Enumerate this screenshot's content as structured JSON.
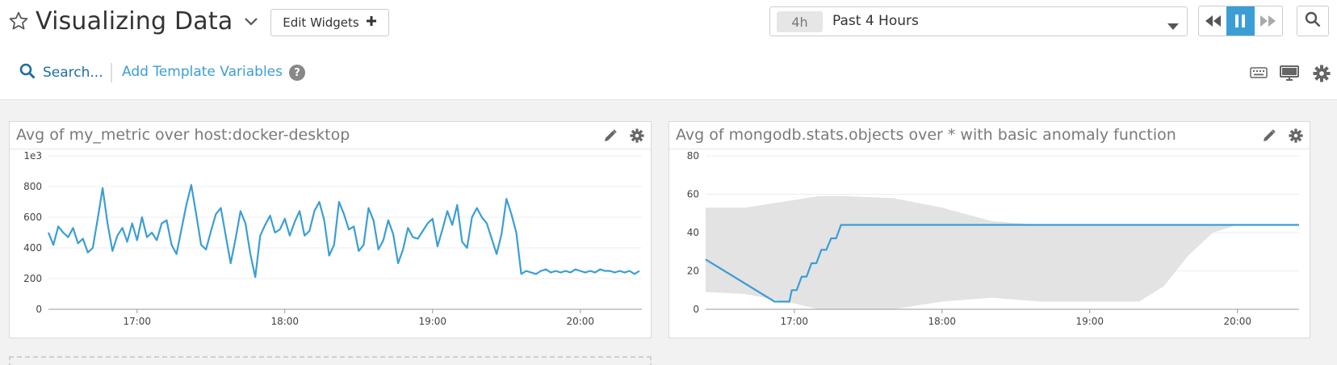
{
  "dashboard": {
    "title": "Visualizing Data",
    "edit_widgets_label": "Edit Widgets"
  },
  "timeframe": {
    "badge": "4h",
    "label": "Past 4 Hours"
  },
  "toolbar": {
    "search_label": "Search...",
    "template_label": "Add Template Variables",
    "help_label": "?"
  },
  "icons": {
    "favorite": "star-icon",
    "title_menu": "chevron-down-icon",
    "edit_add": "plus-icon",
    "time_caret": "caret-down-icon",
    "rewind": "rewind-icon",
    "pause": "pause-icon",
    "forward": "fast-forward-icon",
    "zoom": "search-icon",
    "keyboard": "keyboard-icon",
    "tv_mode": "monitor-icon",
    "settings": "gear-icon",
    "widget_edit": "pencil-icon",
    "widget_settings": "gear-icon"
  },
  "colors": {
    "accent": "#3b9ed5",
    "link": "#1c6ea4",
    "series": "#3b9ed5",
    "band": "#e3e3e3",
    "grid": "#ececec"
  },
  "widgets": [
    {
      "title": "Avg of my_metric over host:docker-desktop"
    },
    {
      "title": "Avg of mongodb.stats.objects over * with basic anomaly function"
    }
  ],
  "chart_data": [
    {
      "type": "line",
      "x_unit": "time (HH:MM)",
      "xlim": [
        "16:24",
        "20:25"
      ],
      "x_ticks": [
        "17:00",
        "18:00",
        "19:00",
        "20:00"
      ],
      "y_ticks": [
        "1e3",
        "800",
        "600",
        "400",
        "200",
        "0"
      ],
      "ylim": [
        0,
        1000
      ],
      "grid": true,
      "series": [
        {
          "x": [
            "16:24",
            "16:26",
            "16:28",
            "16:30",
            "16:32",
            "16:34",
            "16:36",
            "16:38",
            "16:40",
            "16:42",
            "16:44",
            "16:46",
            "16:48",
            "16:50",
            "16:52",
            "16:54",
            "16:56",
            "16:58",
            "17:00",
            "17:02",
            "17:04",
            "17:06",
            "17:08",
            "17:10",
            "17:12",
            "17:14",
            "17:16",
            "17:18",
            "17:20",
            "17:22",
            "17:24",
            "17:26",
            "17:28",
            "17:30",
            "17:32",
            "17:34",
            "17:36",
            "17:38",
            "17:40",
            "17:42",
            "17:44",
            "17:46",
            "17:48",
            "17:50",
            "17:52",
            "17:54",
            "17:56",
            "17:58",
            "18:00",
            "18:02",
            "18:04",
            "18:06",
            "18:08",
            "18:10",
            "18:12",
            "18:14",
            "18:16",
            "18:18",
            "18:20",
            "18:22",
            "18:24",
            "18:26",
            "18:28",
            "18:30",
            "18:32",
            "18:34",
            "18:36",
            "18:38",
            "18:40",
            "18:42",
            "18:44",
            "18:46",
            "18:48",
            "18:50",
            "18:52",
            "18:54",
            "18:56",
            "18:58",
            "19:00",
            "19:02",
            "19:04",
            "19:06",
            "19:08",
            "19:10",
            "19:12",
            "19:14",
            "19:16",
            "19:18",
            "19:20",
            "19:22",
            "19:24",
            "19:26",
            "19:28",
            "19:30",
            "19:32",
            "19:34",
            "19:36",
            "19:38",
            "19:40",
            "19:42",
            "19:44",
            "19:46",
            "19:48",
            "19:50",
            "19:52",
            "19:54",
            "19:56",
            "19:58",
            "20:00",
            "20:02",
            "20:04",
            "20:06",
            "20:08",
            "20:10",
            "20:12",
            "20:14",
            "20:16",
            "20:18",
            "20:20",
            "20:22",
            "20:24"
          ],
          "values": [
            500,
            420,
            540,
            500,
            470,
            530,
            430,
            460,
            370,
            400,
            590,
            790,
            560,
            380,
            480,
            530,
            440,
            560,
            450,
            600,
            470,
            500,
            450,
            560,
            580,
            420,
            360,
            520,
            680,
            810,
            620,
            420,
            390,
            510,
            620,
            660,
            480,
            300,
            460,
            640,
            560,
            360,
            210,
            480,
            550,
            610,
            500,
            520,
            590,
            480,
            570,
            640,
            480,
            510,
            640,
            700,
            580,
            350,
            420,
            700,
            620,
            520,
            540,
            380,
            420,
            660,
            580,
            390,
            450,
            580,
            490,
            300,
            390,
            530,
            470,
            460,
            510,
            560,
            590,
            410,
            520,
            640,
            550,
            680,
            440,
            400,
            600,
            660,
            600,
            560,
            460,
            360,
            490,
            720,
            620,
            500,
            230,
            250,
            240,
            230,
            250,
            260,
            240,
            250,
            240,
            250,
            240,
            260,
            250,
            240,
            250,
            240,
            260,
            250,
            250,
            240,
            250,
            240,
            250,
            230,
            250
          ]
        }
      ]
    },
    {
      "type": "area",
      "x_unit": "time (HH:MM)",
      "xlim": [
        "16:24",
        "20:25"
      ],
      "x_ticks": [
        "17:00",
        "18:00",
        "19:00",
        "20:00"
      ],
      "y_ticks": [
        "80",
        "60",
        "40",
        "20",
        "0"
      ],
      "ylim": [
        0,
        80
      ],
      "grid": true,
      "series": [
        {
          "kind": "line",
          "x": [
            "16:24",
            "16:52",
            "16:58",
            "16:59",
            "17:01",
            "17:03",
            "17:05",
            "17:07",
            "17:09",
            "17:11",
            "17:13",
            "17:15",
            "17:17",
            "17:19",
            "17:21",
            "17:23",
            "17:25",
            "17:27",
            "18:00",
            "19:00",
            "20:00",
            "20:25"
          ],
          "values": [
            26,
            4,
            4,
            10,
            10,
            17,
            17,
            24,
            24,
            31,
            31,
            37,
            37,
            44,
            44,
            44,
            44,
            44,
            44,
            44,
            44,
            44
          ]
        },
        {
          "kind": "band",
          "x": [
            "16:24",
            "16:40",
            "17:00",
            "17:10",
            "17:20",
            "17:40",
            "18:00",
            "18:20",
            "18:40",
            "19:00",
            "19:10",
            "19:20",
            "19:30",
            "19:40",
            "19:50",
            "20:00",
            "20:25"
          ],
          "upper": [
            53,
            53,
            57,
            59,
            59,
            58,
            53,
            46,
            44,
            44,
            44,
            44,
            44,
            44,
            44,
            44,
            44
          ],
          "lower": [
            9,
            8,
            3,
            0,
            0,
            0,
            4,
            6,
            4,
            4,
            4,
            4,
            12,
            28,
            40,
            44,
            44
          ]
        }
      ]
    }
  ]
}
